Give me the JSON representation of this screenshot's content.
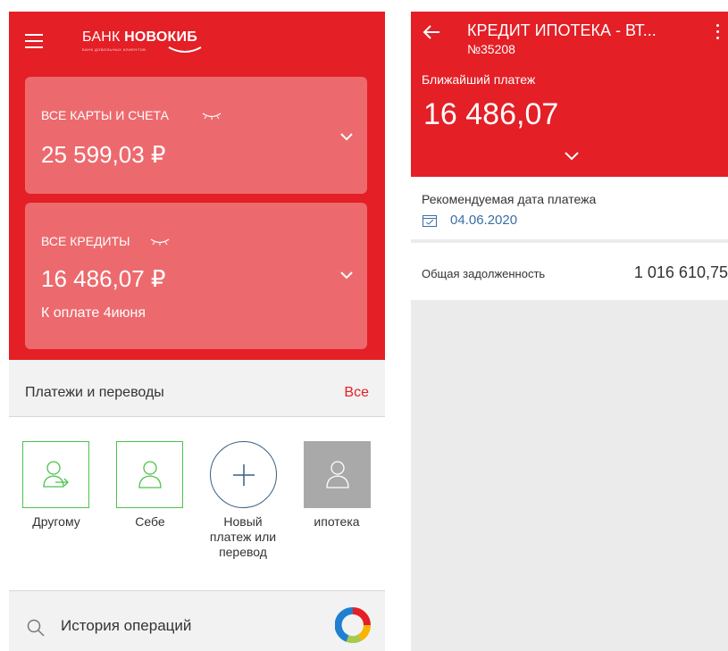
{
  "left": {
    "bank_name_regular": "БАНК ",
    "bank_name_bold": "НОВОКИБ",
    "bank_tagline": "БАНК ДОВОЛЬНЫХ КЛИЕНТОВ",
    "cards": {
      "label": "ВСЕ КАРТЫ И СЧЕТА",
      "amount": "25 599,03 ₽"
    },
    "credits": {
      "label": "ВСЕ КРЕДИТЫ",
      "amount": "16 486,07 ₽",
      "due": "К оплате 4июня"
    },
    "payments": {
      "title": "Платежи и переводы",
      "all_link": "Все",
      "tiles": [
        {
          "label": "Другому"
        },
        {
          "label": "Себе"
        },
        {
          "label": "Новый платеж или перевод"
        },
        {
          "label": "ипотека"
        }
      ]
    },
    "history": {
      "label": "История операций"
    }
  },
  "right": {
    "title": "КРЕДИТ ИПОТЕКА - ВТ...",
    "number": "№35208",
    "nearest_label": "Ближайший платеж",
    "nearest_amount": "16 486,07",
    "recommended_label": "Рекомендуемая дата платежа",
    "recommended_date": "04.06.2020",
    "debt_label": "Общая задолженность",
    "debt_value": "1 016 610,75"
  },
  "colors": {
    "brand_red": "#e41f26",
    "card_pink": "#ec6a6e",
    "success_green": "#4cc24a",
    "link_blue": "#3a6ea5"
  },
  "icons": [
    "menu-icon",
    "eye-closed-icon",
    "chevron-down-icon",
    "user-transfer-icon",
    "user-icon",
    "plus-icon",
    "search-icon",
    "donut-chart-icon",
    "back-arrow-icon",
    "more-vertical-icon",
    "calendar-icon"
  ]
}
